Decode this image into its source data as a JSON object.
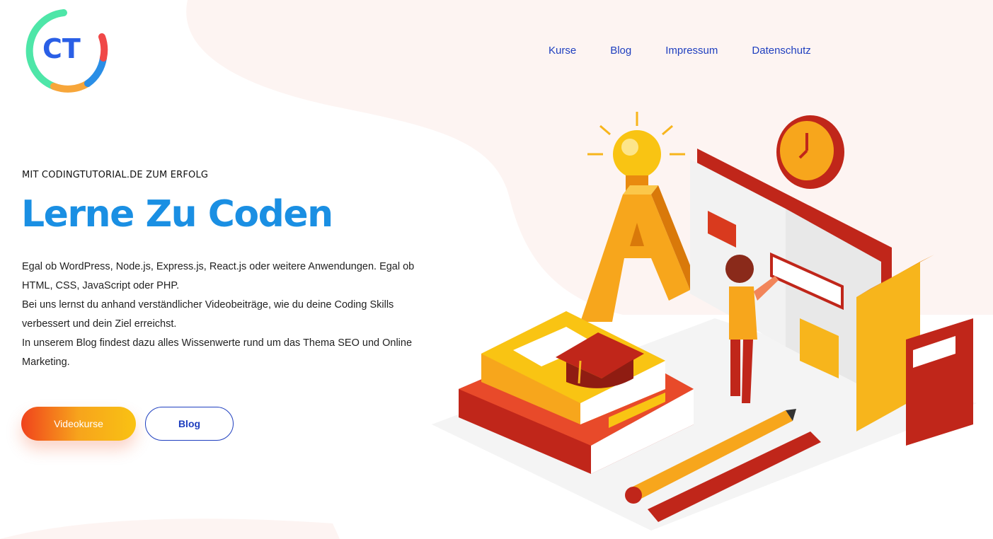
{
  "logo": {
    "text": "CT",
    "icon": "ct-logo-icon"
  },
  "nav": {
    "items": [
      {
        "label": "Kurse"
      },
      {
        "label": "Blog"
      },
      {
        "label": "Impressum"
      },
      {
        "label": "Datenschutz"
      }
    ]
  },
  "hero": {
    "kicker": "MIT CODINGTUTORIAL.DE ZUM ERFOLG",
    "title": "Lerne Zu Coden",
    "paragraphs": [
      "Egal ob WordPress, Node.js, Express.js, React.js oder weitere Anwendungen. Egal ob HTML, CSS, JavaScript oder PHP.",
      "Bei uns lernst du anhand verständlicher Videobeiträge, wie du deine Coding Skills verbessert und dein Ziel erreichst.",
      "In unserem Blog findest dazu alles Wissenwerte rund um das Thema SEO und Online Marketing."
    ],
    "primary_button": "Videokurse",
    "secondary_button": "Blog"
  },
  "illustration": {
    "icon": "isometric-learning-illustration"
  },
  "colors": {
    "accent_blue": "#1a8fe3",
    "nav_blue": "#1f3fbf",
    "orange": "#f7a41c",
    "red": "#c0261a",
    "blob": "#fdf4f2"
  }
}
